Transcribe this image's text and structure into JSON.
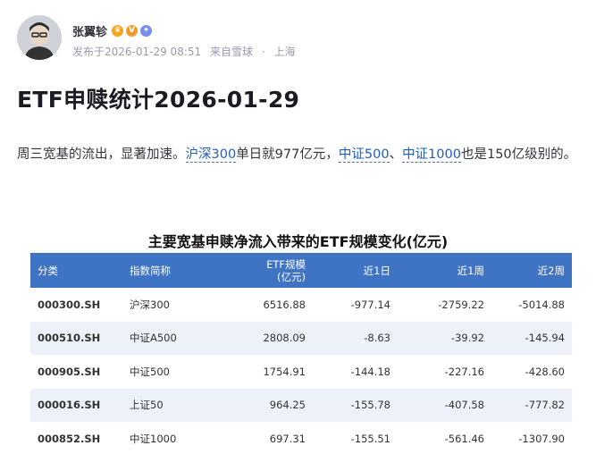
{
  "author": {
    "name": "张翼轸",
    "published": "发布于2026-01-29 08:51",
    "source": "来自雪球",
    "separator": "·",
    "location": "上海",
    "badges": [
      "crown-badge-icon",
      "v-badge-icon",
      "star-badge-icon"
    ]
  },
  "article": {
    "title": "ETF申赎统计2026-01-29",
    "para_part1": "周三宽基的流出，显著加速。",
    "link1": "沪深300",
    "para_part2": "单日就977亿元，",
    "link2": "中证500",
    "para_part3": "、",
    "link3": "中证1000",
    "para_part4": "也是150亿级别的。"
  },
  "table": {
    "title": "主要宽基申赎净流入带来的ETF规模变化(亿元)",
    "headers": {
      "code": "分类",
      "name": "指数简称",
      "size_line1": "ETF规模",
      "size_line2": "(亿元)",
      "d1": "近1日",
      "w1": "近1周",
      "w2": "近2周"
    },
    "rows": [
      {
        "code": "000300.SH",
        "name": "沪深300",
        "size": "6516.88",
        "d1": "-977.14",
        "w1": "-2759.22",
        "w2": "-5014.88"
      },
      {
        "code": "000510.SH",
        "name": "中证A500",
        "size": "2808.09",
        "d1": "-8.63",
        "w1": "-39.92",
        "w2": "-145.94"
      },
      {
        "code": "000905.SH",
        "name": "中证500",
        "size": "1754.91",
        "d1": "-144.18",
        "w1": "-227.16",
        "w2": "-428.60"
      },
      {
        "code": "000016.SH",
        "name": "上证50",
        "size": "964.25",
        "d1": "-155.78",
        "w1": "-407.58",
        "w2": "-777.82"
      },
      {
        "code": "000852.SH",
        "name": "中证1000",
        "size": "697.31",
        "d1": "-155.51",
        "w1": "-561.46",
        "w2": "-1307.90"
      }
    ]
  },
  "colors": {
    "header_bg": "#3f74c4",
    "row_alt_bg": "#edf2fa",
    "link": "#1f5fbf"
  }
}
